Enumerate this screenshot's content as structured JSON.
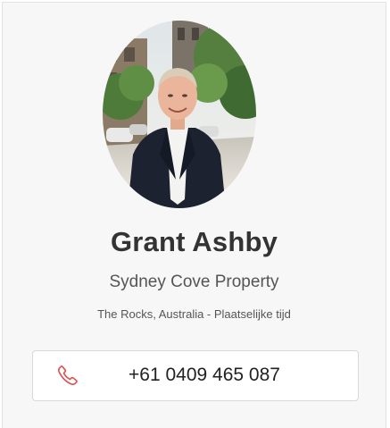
{
  "agent": {
    "name": "Grant Ashby",
    "company": "Sydney Cove Property",
    "location": "The Rocks, Australia - Plaatselijke tijd",
    "photo_icon": "agent-portrait"
  },
  "contact": {
    "phone_icon": "phone-icon",
    "phone_number": "+61 0409 465 087",
    "accent_color": "#d9534f"
  }
}
